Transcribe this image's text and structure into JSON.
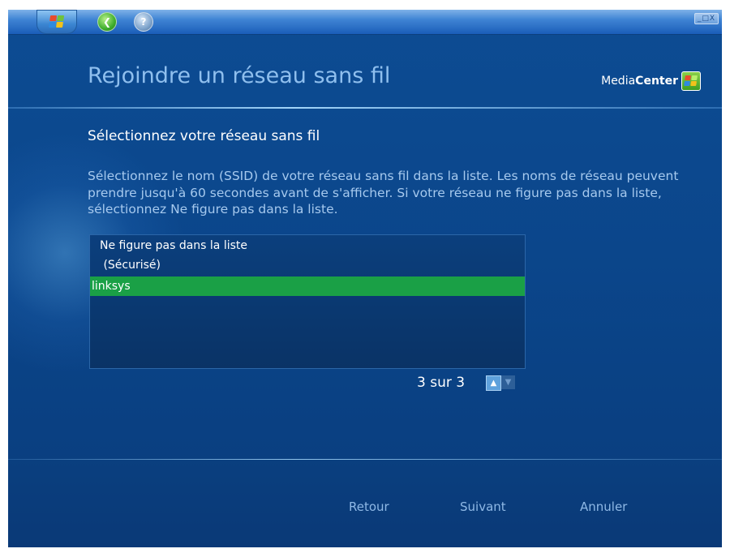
{
  "window": {
    "controls_label": "_□X"
  },
  "titlebar": {
    "start_button": "windows-start-button",
    "back_icon": "back-arrow-icon",
    "help_icon": "help-icon"
  },
  "header": {
    "title": "Rejoindre un réseau sans fil",
    "brand_prefix": "Media",
    "brand_bold": "Center"
  },
  "content": {
    "subtitle": "Sélectionnez votre réseau sans fil",
    "description": "Sélectionnez le nom (SSID) de votre réseau sans fil dans la liste. Les noms de réseau peuvent prendre jusqu'à 60 secondes avant de s'afficher. Si votre réseau ne figure pas dans la liste, sélectionnez Ne figure pas dans la liste."
  },
  "network_list": {
    "items": [
      {
        "label": "Ne figure pas dans la liste",
        "selected": false
      },
      {
        "label": " (Sécurisé)",
        "selected": false
      },
      {
        "label": "linksys",
        "selected": true
      }
    ],
    "pager_text": "3 sur 3"
  },
  "footer": {
    "back_label": "Retour",
    "next_label": "Suivant",
    "cancel_label": "Annuler"
  },
  "colors": {
    "background": "#0b468b",
    "selection": "#1aa046",
    "title_text": "#8fbfee"
  }
}
